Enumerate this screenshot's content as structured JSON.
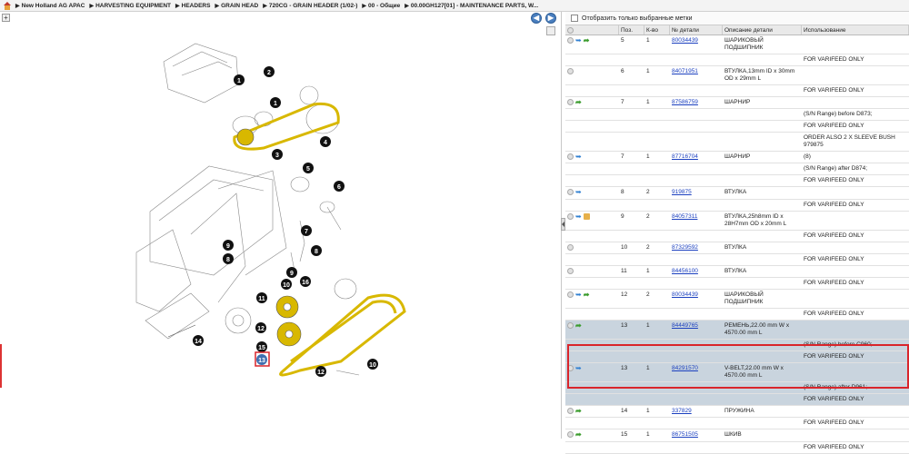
{
  "breadcrumb": [
    "New Holland AG APAC",
    "HARVESTING EQUIPMENT",
    "HEADERS",
    "GRAIN HEAD",
    "720CG - GRAIN HEADER (1/02-)",
    "00 - Общие",
    "00.00GH127[01] - MAINTENANCE PARTS, W..."
  ],
  "toolbar": {
    "expand": "+",
    "back": "◀",
    "forward": "▶"
  },
  "filter": {
    "label": "Отобразить только выбранные метки"
  },
  "columns": [
    "",
    "Поз.",
    "К-во",
    "№ детали",
    "Описание детали",
    "Использование"
  ],
  "callouts": [
    "1",
    "2",
    "1",
    "3",
    "4",
    "5",
    "6",
    "7",
    "8",
    "9",
    "8",
    "9",
    "10",
    "16",
    "11",
    "12",
    "15",
    "13",
    "14",
    "12",
    "10"
  ],
  "rows": [
    {
      "icons": [
        "circle",
        "blue",
        "green"
      ],
      "pos": "5",
      "qty": "1",
      "part": "80034439",
      "desc": "ШАРИКОВЫЙ ПОДШИПНИК",
      "usage": ""
    },
    {
      "icons": [],
      "pos": "",
      "qty": "",
      "part": "",
      "desc": "",
      "usage": "FOR VARIFEED ONLY"
    },
    {
      "icons": [
        "circle"
      ],
      "pos": "6",
      "qty": "1",
      "part": "84071951",
      "desc": "ВТУЛКА,13mm ID x 30mm OD x 29mm L",
      "usage": ""
    },
    {
      "icons": [],
      "pos": "",
      "qty": "",
      "part": "",
      "desc": "",
      "usage": "FOR VARIFEED ONLY"
    },
    {
      "icons": [
        "circle",
        "green"
      ],
      "pos": "7",
      "qty": "1",
      "part": "87586759",
      "desc": "ШАРНИР",
      "usage": ""
    },
    {
      "icons": [],
      "pos": "",
      "qty": "",
      "part": "",
      "desc": "",
      "usage": "(S/N Range) before D873;"
    },
    {
      "icons": [],
      "pos": "",
      "qty": "",
      "part": "",
      "desc": "",
      "usage": "FOR VARIFEED ONLY"
    },
    {
      "icons": [],
      "pos": "",
      "qty": "",
      "part": "",
      "desc": "",
      "usage": "ORDER ALSO 2 X SLEEVE BUSH 979875"
    },
    {
      "icons": [
        "circle",
        "blue"
      ],
      "pos": "7",
      "qty": "1",
      "part": "87716704",
      "desc": "ШАРНИР",
      "usage": "(8)"
    },
    {
      "icons": [],
      "pos": "",
      "qty": "",
      "part": "",
      "desc": "",
      "usage": "(S/N Range) after D874;"
    },
    {
      "icons": [],
      "pos": "",
      "qty": "",
      "part": "",
      "desc": "",
      "usage": "FOR VARIFEED ONLY"
    },
    {
      "icons": [
        "circle",
        "blue"
      ],
      "pos": "8",
      "qty": "2",
      "part": "919875",
      "desc": "ВТУЛКА",
      "usage": ""
    },
    {
      "icons": [],
      "pos": "",
      "qty": "",
      "part": "",
      "desc": "",
      "usage": "FOR VARIFEED ONLY"
    },
    {
      "icons": [
        "circle",
        "blue",
        "box"
      ],
      "pos": "9",
      "qty": "2",
      "part": "84057311",
      "desc": "ВТУЛКА,25h8mm ID x 28H7mm OD x 20mm L",
      "usage": ""
    },
    {
      "icons": [],
      "pos": "",
      "qty": "",
      "part": "",
      "desc": "",
      "usage": "FOR VARIFEED ONLY"
    },
    {
      "icons": [
        "circle"
      ],
      "pos": "10",
      "qty": "2",
      "part": "87329592",
      "desc": "ВТУЛКА",
      "usage": ""
    },
    {
      "icons": [],
      "pos": "",
      "qty": "",
      "part": "",
      "desc": "",
      "usage": "FOR VARIFEED ONLY"
    },
    {
      "icons": [
        "circle"
      ],
      "pos": "11",
      "qty": "1",
      "part": "84456100",
      "desc": "ВТУЛКА",
      "usage": ""
    },
    {
      "icons": [],
      "pos": "",
      "qty": "",
      "part": "",
      "desc": "",
      "usage": "FOR VARIFEED ONLY"
    },
    {
      "icons": [
        "circle",
        "blue",
        "green"
      ],
      "pos": "12",
      "qty": "2",
      "part": "80034439",
      "desc": "ШАРИКОВЫЙ ПОДШИПНИК",
      "usage": ""
    },
    {
      "icons": [],
      "pos": "",
      "qty": "",
      "part": "",
      "desc": "",
      "usage": "FOR VARIFEED ONLY"
    },
    {
      "icons": [
        "circle",
        "green"
      ],
      "pos": "13",
      "qty": "1",
      "part": "84449765",
      "desc": "РЕМЕНЬ,22.00 mm W x 4570.00 mm L",
      "usage": "",
      "state": "sel"
    },
    {
      "icons": [],
      "pos": "",
      "qty": "",
      "part": "",
      "desc": "",
      "usage": "(S/N Range) before C960;",
      "state": "sel"
    },
    {
      "icons": [],
      "pos": "",
      "qty": "",
      "part": "",
      "desc": "",
      "usage": "FOR VARIFEED ONLY",
      "state": "sel"
    },
    {
      "icons": [
        "circle",
        "blue"
      ],
      "pos": "13",
      "qty": "1",
      "part": "84291570",
      "desc": "V-BELT,22.00 mm W x 4570.00 mm L",
      "usage": "",
      "state": "hl"
    },
    {
      "icons": [],
      "pos": "",
      "qty": "",
      "part": "",
      "desc": "",
      "usage": "(S/N Range) after D961;",
      "state": "hl"
    },
    {
      "icons": [],
      "pos": "",
      "qty": "",
      "part": "",
      "desc": "",
      "usage": "FOR VARIFEED ONLY",
      "state": "hl"
    },
    {
      "icons": [
        "circle",
        "green"
      ],
      "pos": "14",
      "qty": "1",
      "part": "337829",
      "desc": "ПРУЖИНА",
      "usage": ""
    },
    {
      "icons": [],
      "pos": "",
      "qty": "",
      "part": "",
      "desc": "",
      "usage": "FOR VARIFEED ONLY"
    },
    {
      "icons": [
        "circle",
        "green"
      ],
      "pos": "15",
      "qty": "1",
      "part": "86751505",
      "desc": "ШКИВ",
      "usage": ""
    },
    {
      "icons": [],
      "pos": "",
      "qty": "",
      "part": "",
      "desc": "",
      "usage": "FOR VARIFEED ONLY"
    }
  ]
}
